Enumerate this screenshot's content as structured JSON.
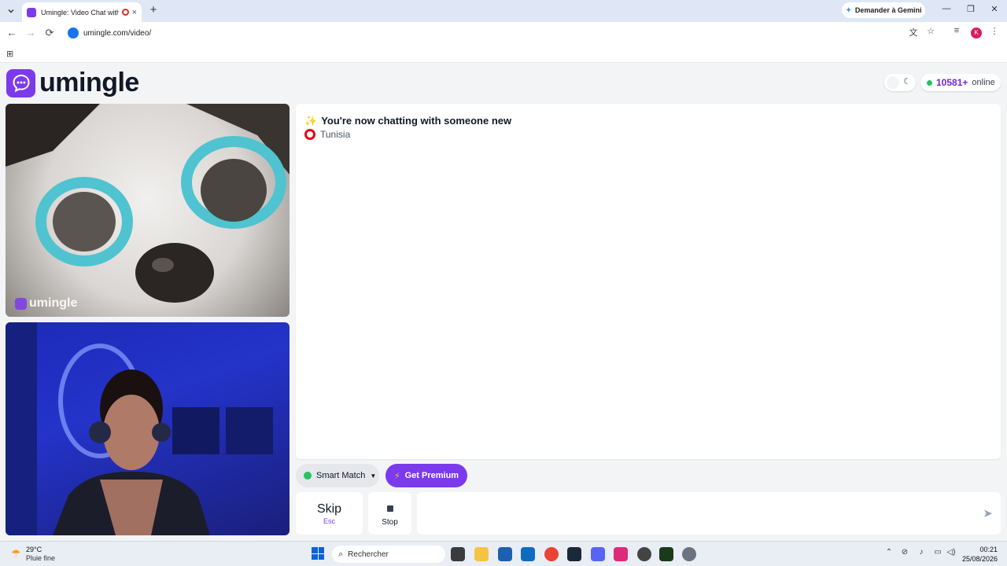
{
  "browser": {
    "tab_title": "Umingle: Video Chat with S",
    "gemini_label": "Demander à Gemini",
    "url": "umingle.com/video/",
    "profile_initial": "K",
    "icons": {
      "tab_menu": "chevron-down-icon",
      "new_tab": "+",
      "close_tab": "×",
      "minimize": "—",
      "maximize": "❐",
      "close": "✕",
      "back": "←",
      "forward": "→",
      "reload": "⟳",
      "translate": "文",
      "star": "☆",
      "media": "≡",
      "menu": "⋮",
      "apps": "⊞"
    }
  },
  "page": {
    "logo_text": "umingle",
    "theme_icon": "☾",
    "online": {
      "count": "10581+",
      "label": "online"
    },
    "remote_video": {
      "watermark": "umingle"
    },
    "chat": {
      "message": "You're now chatting with someone new",
      "message_icon": "✨",
      "country": "Tunisia"
    },
    "controls": {
      "smart_match": "Smart Match",
      "premium": "Get Premium",
      "premium_icon": "⚡",
      "skip": "Skip",
      "skip_key": "Esc",
      "stop": "Stop",
      "send_icon": "➤"
    },
    "colors": {
      "brand": "#7c3aed",
      "online_dot": "#22c55e"
    }
  },
  "taskbar": {
    "weather_temp": "29°C",
    "weather_desc": "Pluie fine",
    "search_placeholder": "Rechercher",
    "time": "00:21",
    "date": "25/08/2026"
  }
}
